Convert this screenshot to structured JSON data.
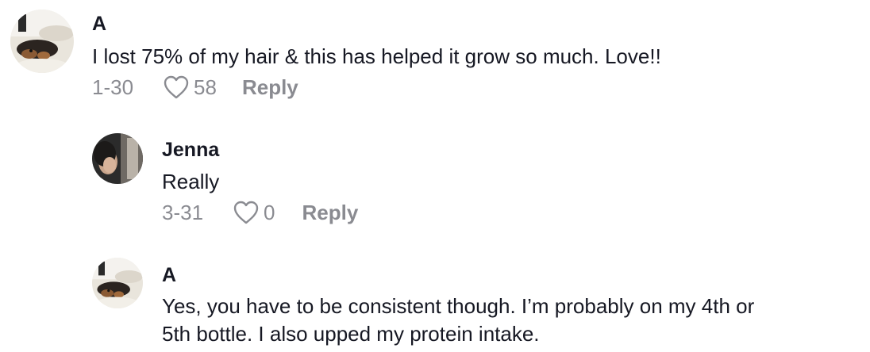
{
  "comments": [
    {
      "username": "A",
      "text_lines": [
        "I lost 75% of my hair & this has helped it grow so much. Love!!"
      ],
      "date": "1-30",
      "likes": "58",
      "reply_label": "Reply",
      "avatar": "dog-photo-avatar"
    },
    {
      "username": "Jenna",
      "text_lines": [
        "Really"
      ],
      "date": "3-31",
      "likes": "0",
      "reply_label": "Reply",
      "avatar": "person-photo-avatar"
    },
    {
      "username": "A",
      "text_lines": [
        "Yes, you have to be consistent though. I’m probably on my 4th or",
        "5th bottle. I also upped my protein intake."
      ],
      "date": "",
      "likes": "",
      "reply_label": "",
      "avatar": "dog-photo-avatar"
    }
  ],
  "colors": {
    "text": "#161823",
    "muted": "#8a8b91"
  },
  "icons": {
    "like": "heart-outline-icon"
  }
}
